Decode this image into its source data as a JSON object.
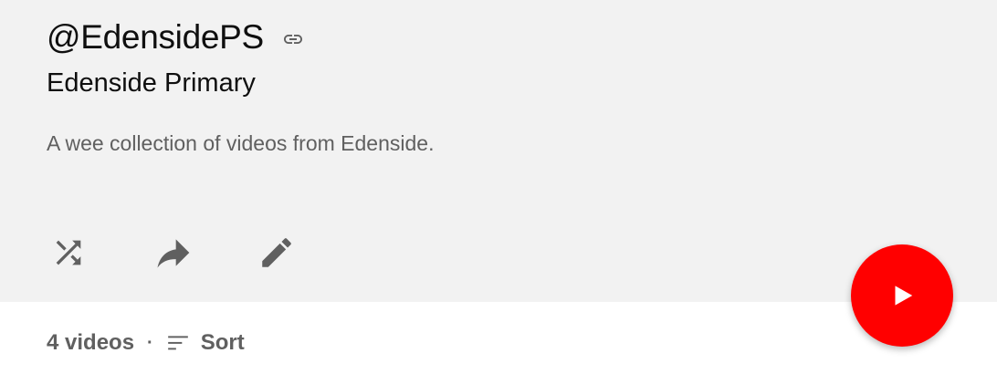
{
  "header": {
    "handle": "@EdensidePS",
    "link_icon": "link-icon",
    "playlist_title": "Edenside Primary",
    "description": "A wee collection of videos from Edenside."
  },
  "actions": [
    {
      "name": "shuffle",
      "icon": "shuffle-icon"
    },
    {
      "name": "share",
      "icon": "share-icon"
    },
    {
      "name": "edit",
      "icon": "pencil-icon"
    }
  ],
  "play_button": {
    "icon": "play-icon",
    "color": "#ff0000"
  },
  "meta": {
    "video_count": "4 videos",
    "separator": "·",
    "sort_label": "Sort",
    "sort_icon": "sort-icon"
  },
  "colors": {
    "header_background": "#f2f2f2",
    "page_background": "#ffffff",
    "primary_text": "#0f0f0f",
    "secondary_text": "#606060",
    "accent": "#ff0000"
  }
}
